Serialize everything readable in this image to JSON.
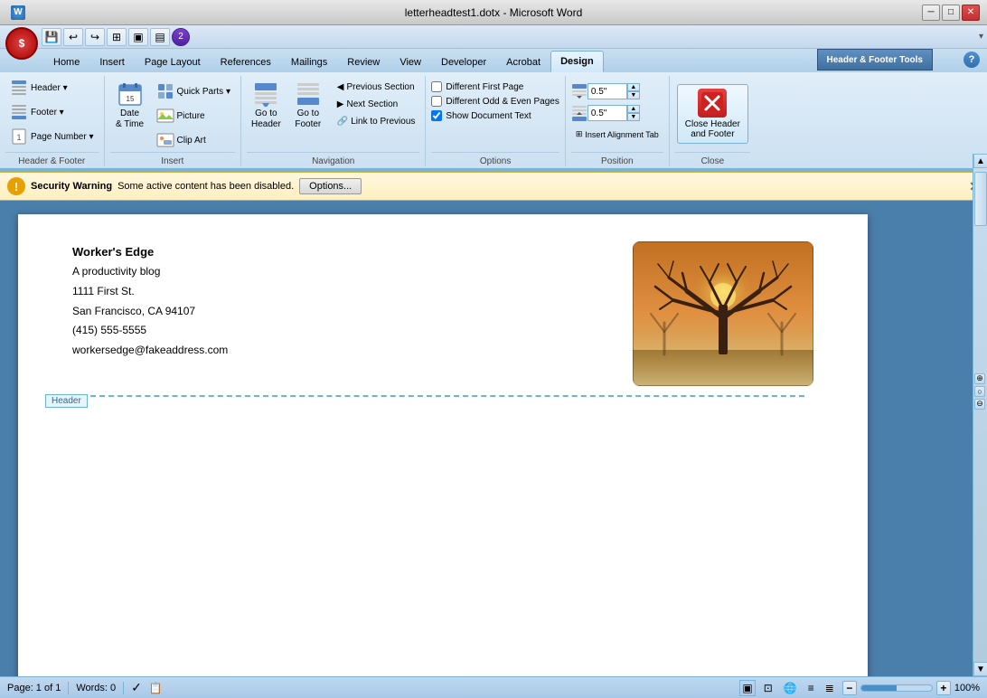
{
  "titleBar": {
    "title": "letterheadtest1.dotx - Microsoft Word"
  },
  "windowControls": {
    "minimize": "─",
    "restore": "□",
    "close": "✕"
  },
  "ribbon": {
    "headerFooterTools": "Header & Footer Tools",
    "tabs": [
      {
        "label": "Home",
        "key": "H",
        "active": false
      },
      {
        "label": "Insert",
        "key": "N",
        "active": false
      },
      {
        "label": "Page Layout",
        "key": "P",
        "active": false
      },
      {
        "label": "References",
        "key": "S",
        "active": false
      },
      {
        "label": "Mailings",
        "key": "M",
        "active": false
      },
      {
        "label": "Review",
        "key": "R",
        "active": false
      },
      {
        "label": "View",
        "key": "W",
        "active": false
      },
      {
        "label": "Developer",
        "key": "L",
        "active": false
      },
      {
        "label": "Acrobat",
        "key": "B",
        "active": false
      },
      {
        "label": "Design",
        "key": "JH",
        "active": true
      }
    ],
    "groups": {
      "headerFooter": {
        "label": "Header & Footer",
        "items": [
          {
            "label": "Header ▾"
          },
          {
            "label": "Footer ▾"
          },
          {
            "label": "Page Number ▾"
          }
        ]
      },
      "insert": {
        "label": "Insert",
        "items": [
          {
            "label": "Date\n& Time"
          },
          {
            "label": "Quick Parts ▾"
          },
          {
            "label": "Picture"
          },
          {
            "label": "Clip Art"
          }
        ]
      },
      "navigation": {
        "label": "Navigation",
        "items": [
          {
            "label": "Go to\nHeader"
          },
          {
            "label": "Go to\nFooter"
          },
          {
            "label": "Previous Section"
          },
          {
            "label": "Next Section"
          },
          {
            "label": "Link to Previous"
          }
        ]
      },
      "options": {
        "label": "Options",
        "items": [
          {
            "label": "Different First Page",
            "checked": false
          },
          {
            "label": "Different Odd & Even Pages",
            "checked": false
          },
          {
            "label": "Show Document Text",
            "checked": true
          }
        ]
      },
      "position": {
        "label": "Position",
        "value1": "0.5\"",
        "value2": "0.5\""
      },
      "close": {
        "label": "Close",
        "buttonLabel": "Close Header\nand Footer"
      }
    }
  },
  "securityBar": {
    "title": "Security Warning",
    "message": "Some active content has been disabled.",
    "optionsBtn": "Options...",
    "icon": "!"
  },
  "document": {
    "companyName": "Worker's Edge",
    "tagline": "A productivity blog",
    "address1": "1111 First St.",
    "city": "San Francisco, CA 94107",
    "phone": "(415) 555-5555",
    "email": "workersedge@fakeaddress.com",
    "headerLabel": "Header"
  },
  "statusBar": {
    "page": "Page: 1 of 1",
    "words": "Words: 0",
    "zoom": "100%"
  },
  "quickAccess": {
    "buttons": [
      "💾",
      "↩",
      "↪",
      "⬛",
      "▣",
      "▤",
      "❷"
    ]
  }
}
